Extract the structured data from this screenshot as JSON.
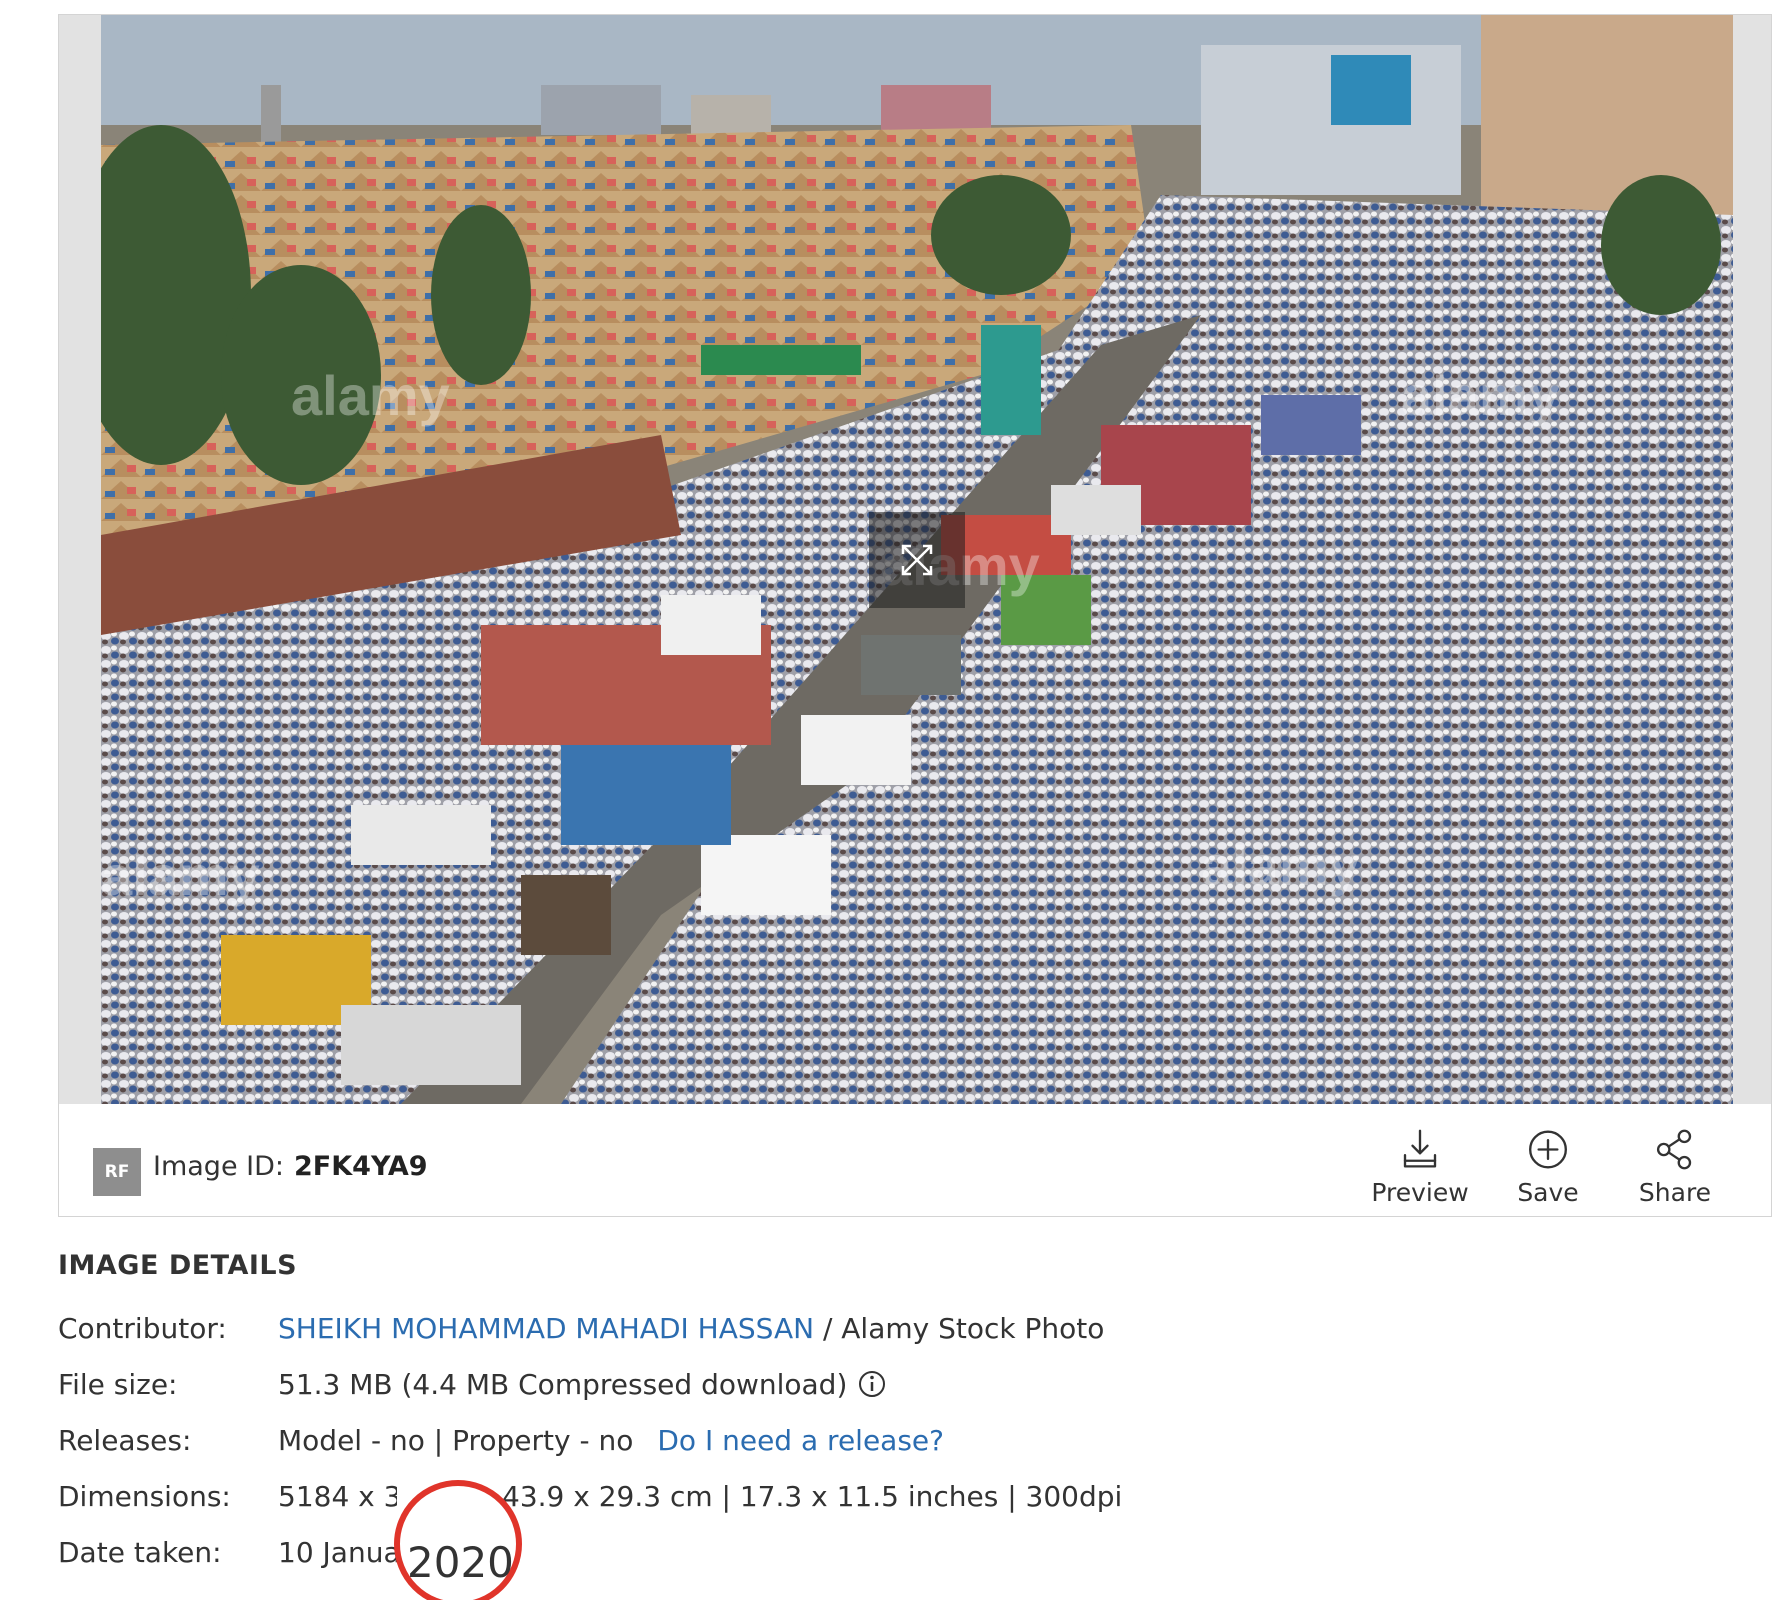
{
  "image": {
    "watermark": "alamy",
    "colors": {
      "sky": "#a9b7c5",
      "road": "#6e6a63",
      "tents": "#c9a87a",
      "crowd": "#b8b6bd",
      "trees": "#3d5a34"
    }
  },
  "info_bar": {
    "badge": "RF",
    "id_label": "Image ID:",
    "id_value": "2FK4YA9",
    "actions": [
      {
        "label": "Preview",
        "icon": "download-icon"
      },
      {
        "label": "Save",
        "icon": "plus-circle-icon"
      },
      {
        "label": "Share",
        "icon": "share-icon"
      }
    ]
  },
  "details": {
    "heading": "IMAGE DETAILS",
    "contributor": {
      "key": "Contributor:",
      "name": "SHEIKH MOHAMMAD MAHADI HASSAN",
      "suffix": " / Alamy Stock Photo"
    },
    "file_size": {
      "key": "File size:",
      "value": "51.3 MB (4.4 MB Compressed download)"
    },
    "releases": {
      "key": "Releases:",
      "value": "Model - no | Property - no",
      "link": "Do I need a release?"
    },
    "dimensions": {
      "key": "Dimensions:",
      "value_start": "5184 x 345",
      "value_end": "43.9 x 29.3 cm | 17.3 x 11.5 inches | 300dpi"
    },
    "date_taken": {
      "key": "Date taken:",
      "value": "10 Janua"
    }
  },
  "annotation": {
    "text": "2020",
    "color": "#e0342a"
  }
}
